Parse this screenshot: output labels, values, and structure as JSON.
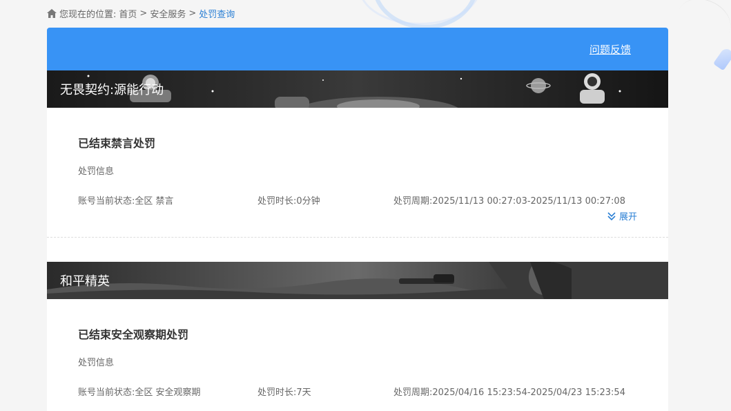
{
  "breadcrumb": {
    "prefix": "您现在的位置:",
    "home": "首页",
    "section": "安全服务",
    "current": "处罚查询",
    "separator": ">"
  },
  "header": {
    "feedback": "问题反馈",
    "color": "#3893f5"
  },
  "games": [
    {
      "name": "无畏契约:源能行动",
      "record": {
        "title": "已结束禁言处罚",
        "subtitle": "处罚信息",
        "status_label": "账号当前状态:",
        "status_value": "全区 禁言",
        "duration_label": "处罚时长:",
        "duration_value": "0分钟",
        "period_label": "处罚周期:",
        "period_value": "2025/11/13 00:27:03-2025/11/13 00:27:08",
        "expand": "展开"
      }
    },
    {
      "name": "和平精英",
      "record": {
        "title": "已结束安全观察期处罚",
        "subtitle": "处罚信息",
        "status_label": "账号当前状态:",
        "status_value": "全区 安全观察期",
        "duration_label": "处罚时长:",
        "duration_value": "7天",
        "period_label": "处罚周期:",
        "period_value": "2025/04/16 15:23:54-2025/04/23 15:23:54"
      }
    }
  ],
  "colors": {
    "link_blue": "#2a7fd4",
    "text_gray": "#666666"
  },
  "icons": {
    "home": "home-icon",
    "expand": "double-chevron-down-icon"
  }
}
